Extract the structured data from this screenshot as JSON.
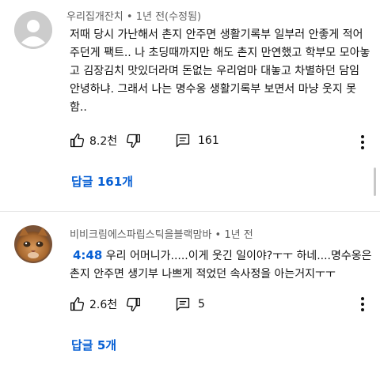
{
  "comments": [
    {
      "author": "우리집개잔치",
      "meta": "• 1년 전(수정됨)",
      "lines": [
        "저때 당시 가난해서 촌지 안주면 생활기록부 일부러 안좋게 적어",
        "주던게 팩트.. 나 초딩때까지만 해도 촌지 만연했고 학부모 모아놓",
        "고 김장김치 맛있더라며 돈없는 우리엄마 대놓고 차별하던 담임",
        "안녕하냐. 그래서 나는 명수옹 생활기록부 보면서  마냥 웃지 못",
        "함.."
      ],
      "likes": "8.2천",
      "reply_count": "161",
      "replies_label": "답글 161개",
      "avatar": "default-person-avatar"
    },
    {
      "author": "비비크림에스파립스틱을블랙맘바",
      "meta": "• 1년 전",
      "timestamp": "4:48",
      "line1_rest": " 우리 어머니가.....이게 웃긴 일이야?ㅜㅜ 하네....명수옹은",
      "line2": "촌지 안주면 생기부 나쁘게 적었던 속사정을 아는거지ㅜㅜ",
      "likes": "2.6천",
      "reply_count": "5",
      "replies_label": "답글 5개",
      "avatar": "cat-photo-avatar"
    }
  ],
  "colors": {
    "link": "#065fd4",
    "meta": "#606060",
    "text": "#0f0f0f",
    "divider": "#e5e5e5"
  },
  "icons": [
    "thumbs-up-icon",
    "thumbs-down-icon",
    "comment-icon",
    "more-vert-icon"
  ]
}
